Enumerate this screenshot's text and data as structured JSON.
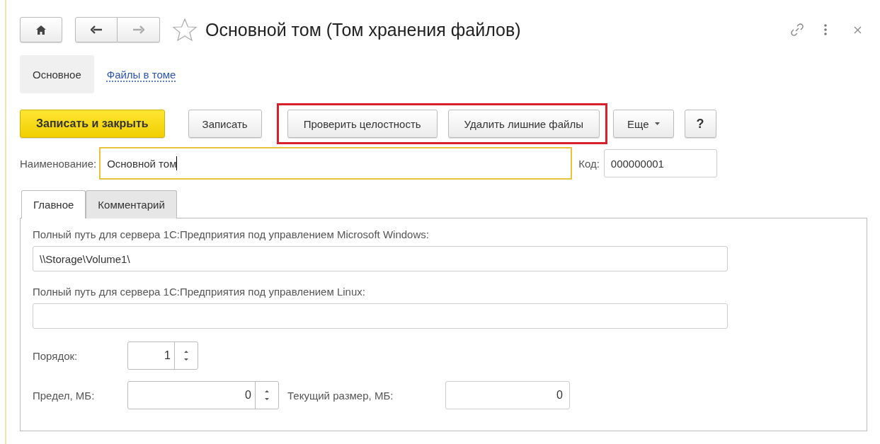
{
  "window": {
    "title": "Основной том (Том хранения файлов)",
    "favorite": false
  },
  "nav_tabs": [
    {
      "label": "Основное",
      "selected": true
    },
    {
      "label": "Файлы в томе",
      "selected": false
    }
  ],
  "toolbar": {
    "buttons": [
      {
        "label": "Записать и закрыть",
        "kind": "primary",
        "highlighted": false
      },
      {
        "label": "Записать",
        "kind": "normal",
        "highlighted": false
      },
      {
        "label": "Проверить целостность",
        "kind": "normal",
        "highlighted": true
      },
      {
        "label": "Удалить лишние файлы",
        "kind": "normal",
        "highlighted": true
      },
      {
        "label": "Еще",
        "kind": "menu",
        "highlighted": false
      },
      {
        "label": "?",
        "kind": "help",
        "highlighted": false
      }
    ]
  },
  "name_field": {
    "label": "Наименование:",
    "value": "Основной том"
  },
  "code_field": {
    "label": "Код:",
    "value": "000000001"
  },
  "tabs": [
    {
      "label": "Главное",
      "selected": true
    },
    {
      "label": "Комментарий",
      "selected": false
    }
  ],
  "main_tab": {
    "windows_path": {
      "label": "Полный путь для сервера 1С:Предприятия под управлением Microsoft Windows:",
      "value": "\\\\Storage\\Volume1\\"
    },
    "linux_path": {
      "label": "Полный путь для сервера 1С:Предприятия под управлением Linux:"
    },
    "order": {
      "label": "Порядок:",
      "value": "1"
    },
    "limit": {
      "label": "Предел, МБ:",
      "value": "0"
    },
    "current_size": {
      "label": "Текущий размер, МБ:",
      "value": "0"
    }
  }
}
